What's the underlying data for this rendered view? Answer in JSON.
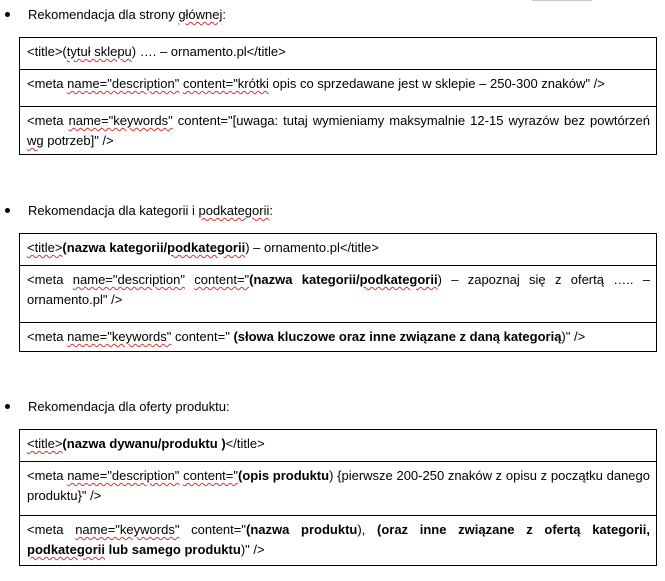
{
  "sections": [
    {
      "title_pre": "Rekomendacja dla strony ",
      "title_sq": "głównej",
      "title_post": ":",
      "rows": {
        "title_open": "<title>(",
        "title_name_sq": "tytuł sklepu",
        "title_rest": ") …. – ornamento.pl</title>",
        "desc_pre": "<meta ",
        "desc_name_sq": "name=\"description\"",
        "desc_mid": " ",
        "desc_content_sq": "content=\"krótki",
        "desc_rest": " opis co sprzedawane jest w sklepie – 250-300 znaków\" />",
        "kw_pre": "<meta  ",
        "kw_name_sq": "name=\"keywords\"",
        "kw_mid": "  content=\"[uwaga: tutaj wymieniamy maksymalnie 12-15 wyrazów bez powtórzeń ",
        "kw_wg_sq": "wg",
        "kw_rest": " potrzeb]\" />"
      }
    },
    {
      "title_pre": "Rekomendacja dla kategorii i ",
      "title_sq": "podkategorii",
      "title_post": ":",
      "rows": {
        "title_tag_sq": "<title>",
        "title_bold_pre": "(nazwa kategorii/",
        "title_bold_sq": "podkategorii",
        "title_rest": ") – ornamento.pl</title>",
        "desc_pre": "<meta ",
        "desc_name_sq": "name=\"description\"",
        "desc_mid": " ",
        "desc_content_sq": "content=\"",
        "desc_bold_pre": "(nazwa kategorii/",
        "desc_bold_sq": "podkategorii",
        "desc_rest": ") – zapoznaj się z ofertą …..  – ornamento.pl\" />",
        "kw_pre": "<meta ",
        "kw_name_sq": "name=\"keywords\"",
        "kw_mid": " content=\" ",
        "kw_bold": "(słowa kluczowe oraz inne związane z daną kategorią",
        "kw_rest": ")\" />"
      }
    },
    {
      "title_pre": "Rekomendacja dla oferty produktu:",
      "rows": {
        "title_tag_sq": "<title>",
        "title_bold": "(nazwa dywanu/produktu )",
        "title_rest": "</title>",
        "desc_pre": "<meta ",
        "desc_name_sq": "name=\"description\"",
        "desc_mid": " ",
        "desc_content_sq": "content=\"",
        "desc_bold": "(opis produktu",
        "desc_rest": ") {pierwsze 200-250 znaków z opisu z początku danego produktu}\" />",
        "kw_pre": "<meta  ",
        "kw_name_sq": "name=\"keywords\"",
        "kw_mid": "  content=\"",
        "kw_bold1": "(nazwa produktu",
        "kw_mid2": "),   ",
        "kw_bold2_pre": "(oraz inne związane z ofertą kategorii, ",
        "kw_bold2_sq": "podkategorii",
        "kw_bold2_rest": " lub samego produktu",
        "kw_rest": ")\" />"
      }
    }
  ]
}
